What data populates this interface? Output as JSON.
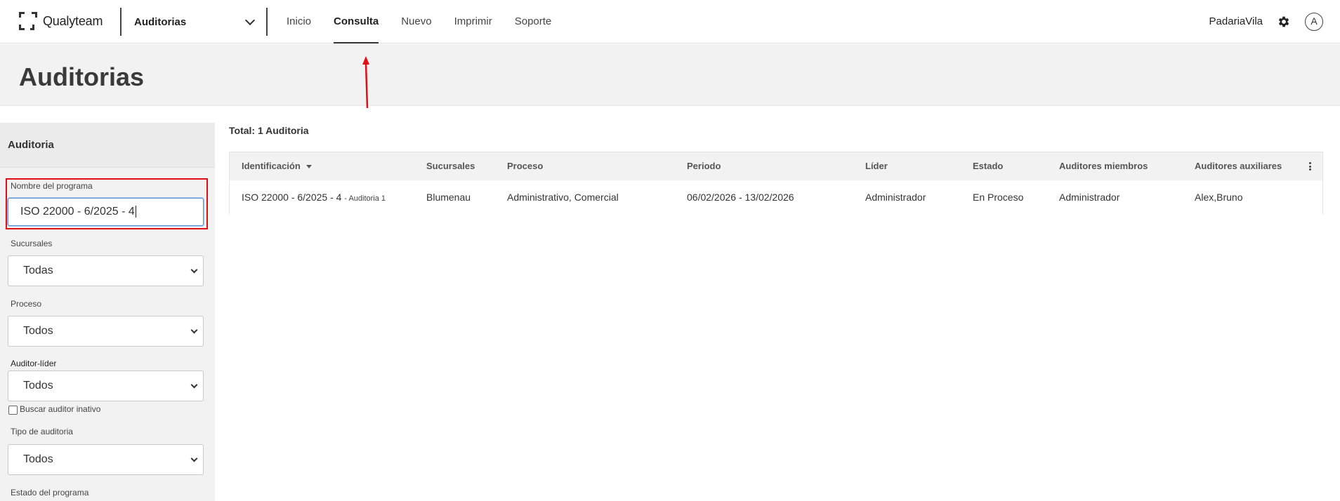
{
  "app": {
    "brand": "Qualyteam",
    "module": "Auditorias"
  },
  "nav": [
    {
      "label": "Inicio",
      "active": false
    },
    {
      "label": "Consulta",
      "active": true
    },
    {
      "label": "Nuevo",
      "active": false
    },
    {
      "label": "Imprimir",
      "active": false
    },
    {
      "label": "Soporte",
      "active": false
    }
  ],
  "user": {
    "company": "PadariaVila",
    "avatar_initial": "A",
    "settings_icon": "gear-icon"
  },
  "page": {
    "title": "Auditorias"
  },
  "sidebar": {
    "title": "Auditoria",
    "program_name": {
      "label": "Nombre del programa",
      "value": "ISO 22000 - 6/2025 - 4"
    },
    "branches": {
      "label": "Sucursales",
      "value": "Todas"
    },
    "process": {
      "label": "Proceso",
      "value": "Todos"
    },
    "lead_auditor": {
      "label": "Auditor-líder",
      "value": "Todos",
      "inactive_checkbox_label": "Buscar auditor inativo",
      "inactive_checked": false
    },
    "audit_type": {
      "label": "Tipo de auditoria",
      "value": "Todos"
    },
    "program_status": {
      "label": "Estado del programa"
    }
  },
  "results": {
    "total": "Total: 1 Auditoria",
    "columns": [
      "Identificación",
      "Sucursales",
      "Proceso",
      "Periodo",
      "Líder",
      "Estado",
      "Auditores miembros",
      "Auditores auxiliares"
    ],
    "rows": [
      {
        "id": "ISO 22000 - 6/2025 - 4",
        "id_suffix": "- Auditoria 1",
        "branches": "Blumenau",
        "process": "Administrativo, Comercial",
        "period": "06/02/2026 - 13/02/2026",
        "leader": "Administrador",
        "status": "En Proceso",
        "members": "Administrador",
        "aux": "Alex,Bruno"
      }
    ]
  },
  "colors": {
    "highlight": "#e10f14",
    "annotation_arrow": "#e10f14",
    "header_bg": "#f2f2f2"
  }
}
